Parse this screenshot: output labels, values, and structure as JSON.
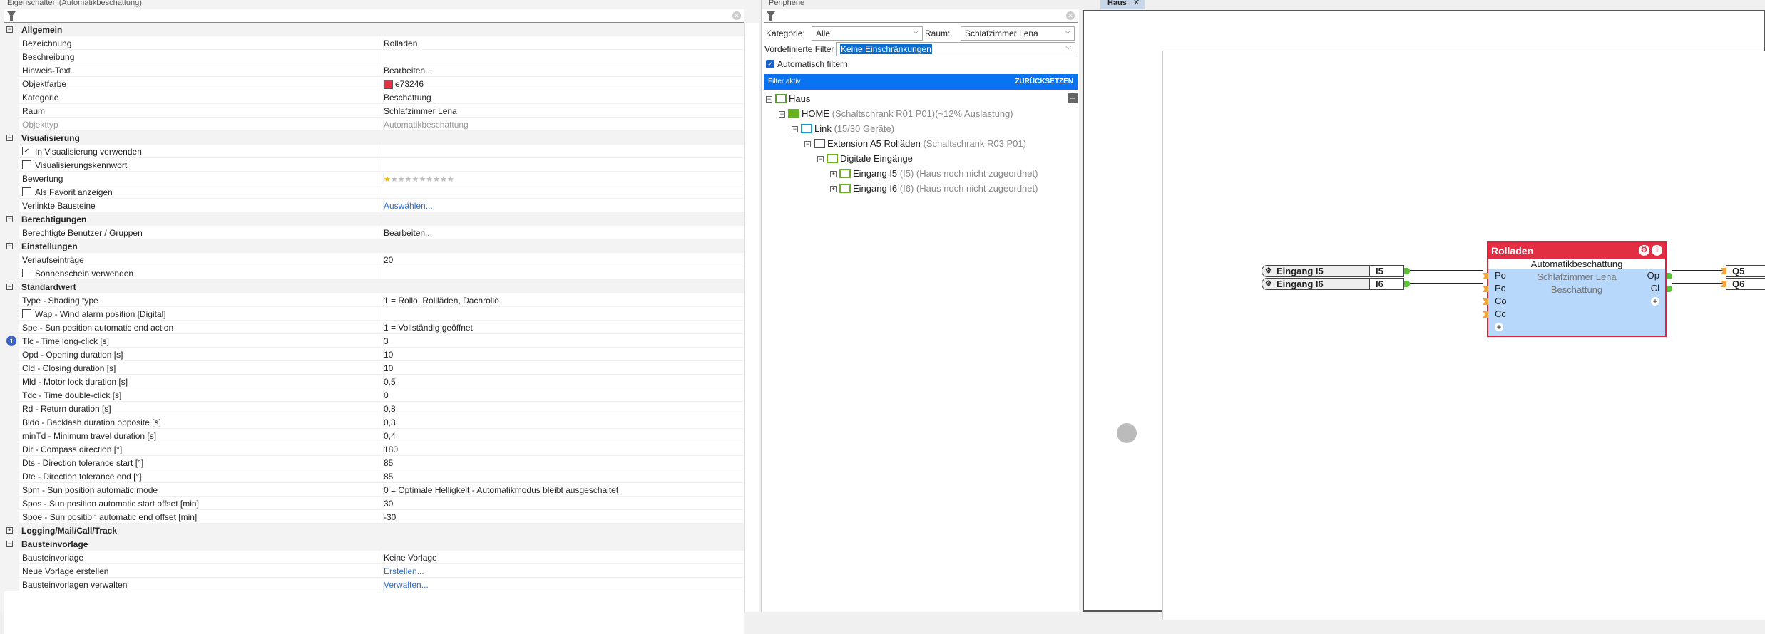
{
  "properties_panel": {
    "title": "Eigenschaften (Automatikbeschattung)",
    "sections": [
      {
        "label": "Allgemein",
        "expanded": true,
        "rows": [
          {
            "label": "Bezeichnung",
            "value": "Rolladen"
          },
          {
            "label": "Beschreibung",
            "value": ""
          },
          {
            "label": "Hinweis-Text",
            "value": "Bearbeiten..."
          },
          {
            "label": "Objektfarbe",
            "value": "e73246",
            "type": "color",
            "color": "#e73246"
          },
          {
            "label": "Kategorie",
            "value": "Beschattung"
          },
          {
            "label": "Raum",
            "value": "Schlafzimmer Lena"
          },
          {
            "label": "Objekttyp",
            "value": "Automatikbeschattung",
            "type": "disabled"
          }
        ]
      },
      {
        "label": "Visualisierung",
        "expanded": true,
        "rows": [
          {
            "label": "In Visualisierung verwenden",
            "type": "checkbox",
            "checked": true
          },
          {
            "label": "Visualisierungskennwort",
            "type": "checkbox",
            "checked": false
          },
          {
            "label": "Bewertung",
            "type": "rating",
            "rating": 1,
            "max": 10
          },
          {
            "label": "Als Favorit anzeigen",
            "type": "checkbox",
            "checked": false
          },
          {
            "label": "Verlinkte Bausteine",
            "value": "Auswählen...",
            "type": "link"
          }
        ]
      },
      {
        "label": "Berechtigungen",
        "expanded": true,
        "rows": [
          {
            "label": "Berechtigte Benutzer / Gruppen",
            "value": "Bearbeiten..."
          }
        ]
      },
      {
        "label": "Einstellungen",
        "expanded": true,
        "rows": [
          {
            "label": "Verlaufseinträge",
            "value": "20"
          },
          {
            "label": "Sonnenschein verwenden",
            "type": "checkbox",
            "checked": false
          }
        ]
      },
      {
        "label": "Standardwert",
        "expanded": true,
        "rows": [
          {
            "label": "Type - Shading type",
            "value": "1 = Rollo, Rollläden, Dachrollo"
          },
          {
            "label": "Wap - Wind alarm position [Digital]",
            "type": "checkbox",
            "checked": false
          },
          {
            "label": "Spe - Sun position automatic end action",
            "value": "1 = Vollständig geöffnet"
          },
          {
            "label": "Tlc - Time long-click [s]",
            "value": "3",
            "info": true
          },
          {
            "label": "Opd - Opening duration [s]",
            "value": "10"
          },
          {
            "label": "Cld - Closing duration [s]",
            "value": "10"
          },
          {
            "label": "Mld - Motor lock duration [s]",
            "value": "0,5"
          },
          {
            "label": "Tdc - Time double-click [s]",
            "value": "0"
          },
          {
            "label": "Rd - Return duration [s]",
            "value": "0,8"
          },
          {
            "label": "Bldo - Backlash duration opposite [s]",
            "value": "0,3"
          },
          {
            "label": "minTd - Minimum travel duration [s]",
            "value": "0,4"
          },
          {
            "label": "Dir - Compass direction [°]",
            "value": "180"
          },
          {
            "label": "Dts - Direction tolerance start [°]",
            "value": "85"
          },
          {
            "label": "Dte - Direction tolerance end [°]",
            "value": "85"
          },
          {
            "label": "Spm - Sun position automatic mode",
            "value": "0 = Optimale Helligkeit - Automatikmodus bleibt ausgeschaltet"
          },
          {
            "label": "Spos - Sun position automatic start offset [min]",
            "value": "30"
          },
          {
            "label": "Spoe - Sun position automatic end offset [min]",
            "value": "-30"
          }
        ]
      },
      {
        "label": "Logging/Mail/Call/Track",
        "expanded": false,
        "rows": []
      },
      {
        "label": "Bausteinvorlage",
        "expanded": true,
        "rows": [
          {
            "label": "Bausteinvorlage",
            "value": "Keine Vorlage"
          },
          {
            "label": "Neue Vorlage erstellen",
            "value": "Erstellen...",
            "type": "link"
          },
          {
            "label": "Bausteinvorlagen verwalten",
            "value": "Verwalten...",
            "type": "link"
          }
        ]
      }
    ]
  },
  "peripherals_panel": {
    "title": "Peripherie",
    "kategorie_label": "Kategorie:",
    "kategorie_value": "Alle",
    "raum_label": "Raum:",
    "raum_value": "Schlafzimmer Lena",
    "predefined_label": "Vordefinierte Filter",
    "predefined_value": "Keine Einschränkungen",
    "auto_filter_label": "Automatisch filtern",
    "filter_active": "Filter aktiv",
    "reset": "ZURÜCKSETZEN",
    "tree": [
      {
        "name": "Haus",
        "detail": ""
      },
      {
        "name": "HOME",
        "detail": "(Schaltschrank R01 P01)(~12% Auslastung)"
      },
      {
        "name": "Link",
        "detail": "(15/30 Geräte)"
      },
      {
        "name": "Extension A5 Rolläden",
        "detail": "(Schaltschrank R03 P01)"
      },
      {
        "name": "Digitale Eingänge",
        "detail": ""
      },
      {
        "name": "Eingang I5",
        "detail": "(I5) (Haus noch nicht zugeordnet)"
      },
      {
        "name": "Eingang I6",
        "detail": "(I6) (Haus noch nicht zugeordnet)"
      }
    ]
  },
  "canvas": {
    "tab": "Haus",
    "inputs": [
      {
        "name": "Eingang I5",
        "id": "I5"
      },
      {
        "name": "Eingang I6",
        "id": "I6"
      }
    ],
    "block": {
      "title": "Rolladen",
      "type": "Automatikbeschattung",
      "room": "Schlafzimmer Lena",
      "category": "Beschattung",
      "in_ports": [
        "Po",
        "Pc",
        "Co",
        "Cc"
      ],
      "out_ports": [
        "Op",
        "Cl"
      ],
      "color": "#e73246"
    },
    "outputs": [
      "Q5",
      "Q6"
    ]
  }
}
